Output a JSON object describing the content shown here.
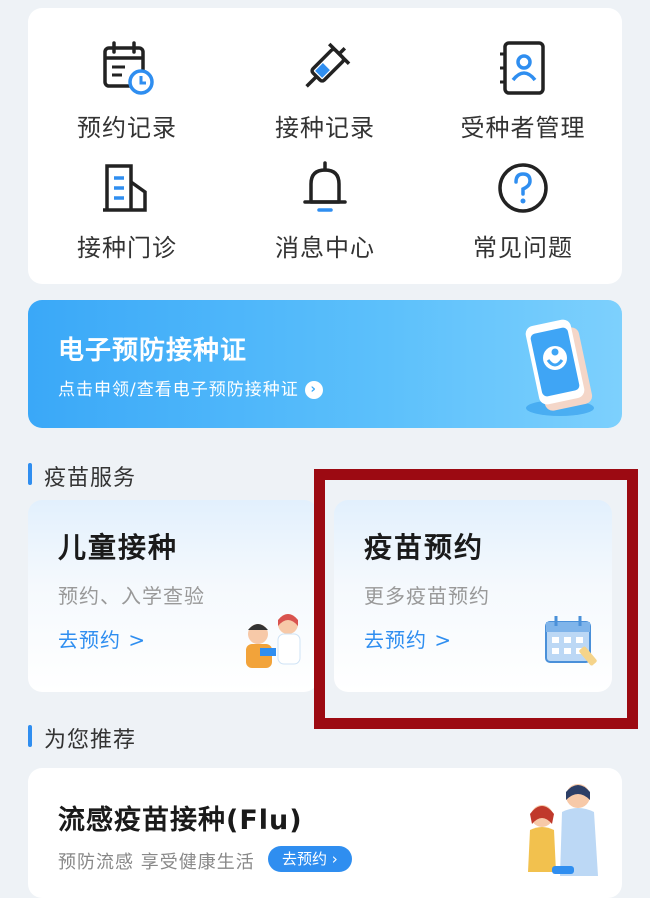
{
  "quick_actions": [
    {
      "label": "预约记录",
      "icon": "calendar-clock-icon"
    },
    {
      "label": "接种记录",
      "icon": "syringe-icon"
    },
    {
      "label": "受种者管理",
      "icon": "contact-book-icon"
    },
    {
      "label": "接种门诊",
      "icon": "building-icon"
    },
    {
      "label": "消息中心",
      "icon": "bell-icon"
    },
    {
      "label": "常见问题",
      "icon": "question-circle-icon"
    }
  ],
  "banner": {
    "title": "电子预防接种证",
    "subtitle": "点击申领/查看电子预防接种证",
    "chevron": "›"
  },
  "vaccine_section": {
    "title": "疫苗服务",
    "cards": [
      {
        "title": "儿童接种",
        "desc": "预约、入学查验",
        "link": "去预约 >"
      },
      {
        "title": "疫苗预约",
        "desc": "更多疫苗预约",
        "link": "去预约 >"
      }
    ]
  },
  "recommend_section": {
    "title": "为您推荐",
    "flu": {
      "title": "流感疫苗接种(Flu)",
      "desc": "预防流感 享受健康生活",
      "button": "去预约 ›"
    }
  },
  "colors": {
    "accent": "#2f8ef0",
    "highlight_border": "#9c0a12",
    "banner_start": "#3aa8f8"
  }
}
